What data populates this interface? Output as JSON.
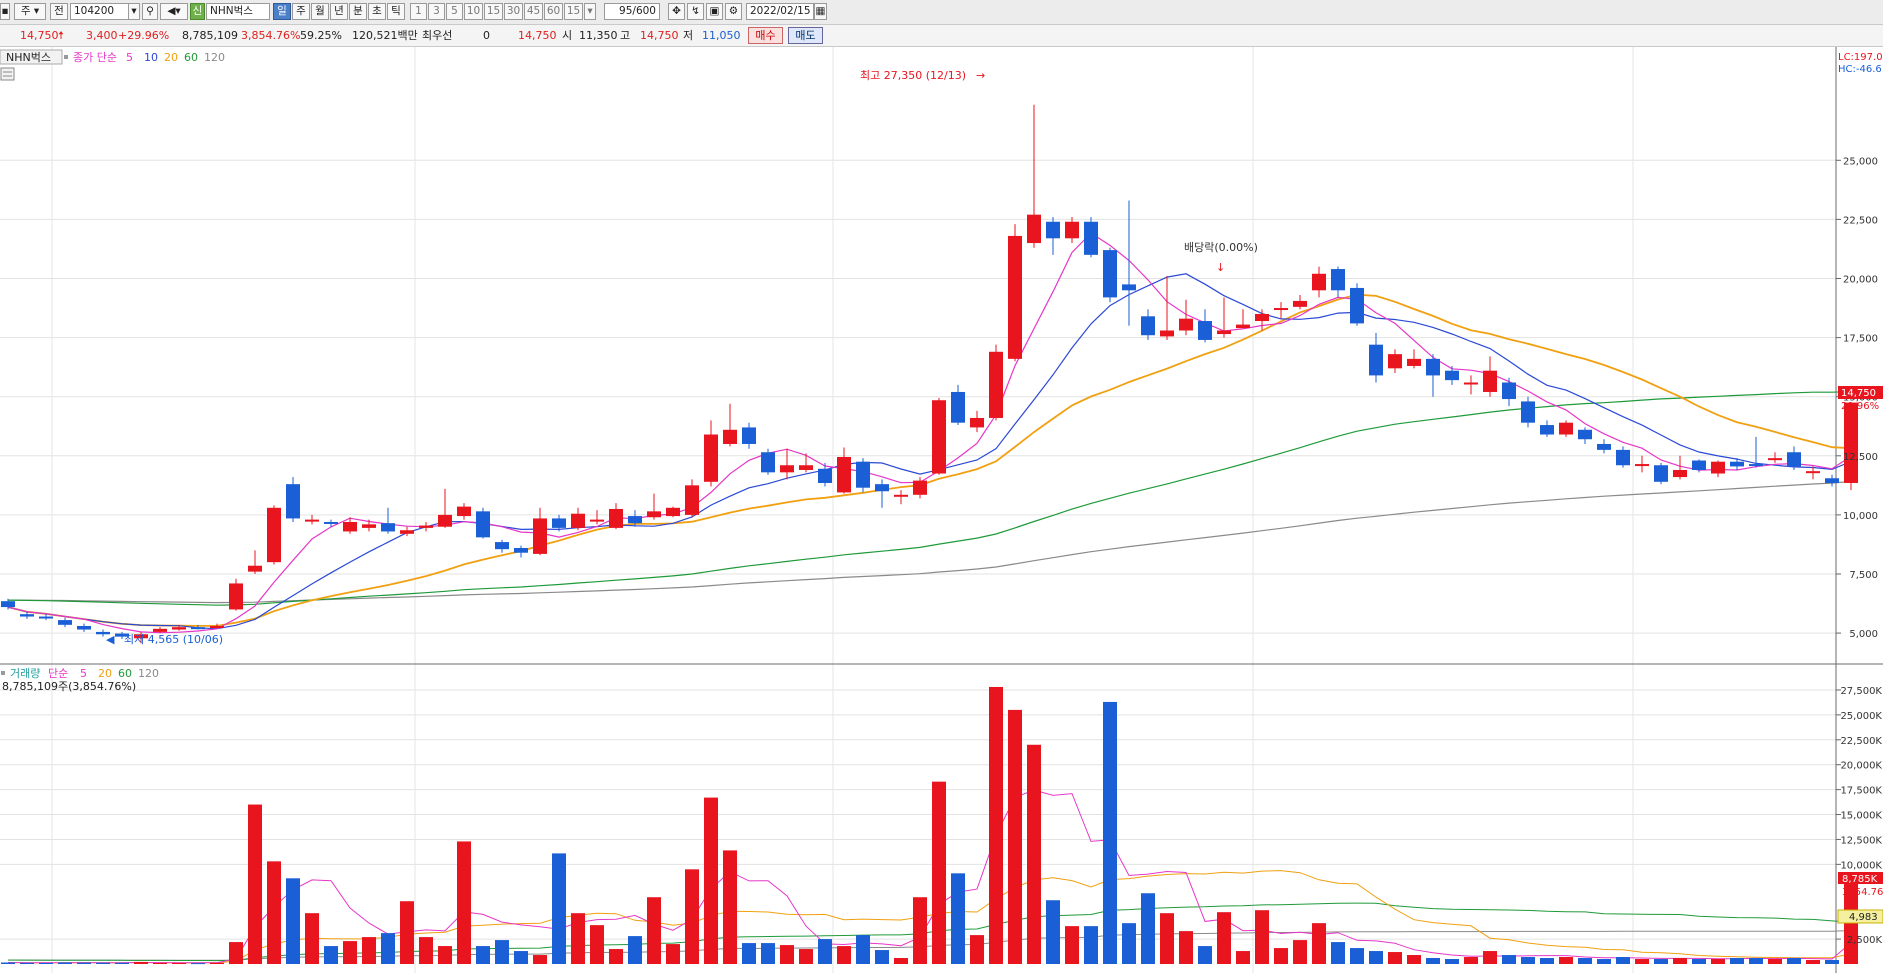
{
  "toolbar": {
    "market_label": "주",
    "all_label": "전",
    "code": "104200",
    "badge": "신",
    "stock_name": "NHN벅스",
    "period_tabs": [
      "일",
      "주",
      "월",
      "년",
      "분",
      "초",
      "틱"
    ],
    "intervals": [
      "1",
      "3",
      "5",
      "10",
      "15",
      "30",
      "45",
      "60",
      "15"
    ],
    "count": "95/600",
    "date": "2022/02/15"
  },
  "infobar": {
    "price": "14,750",
    "change": "3,400",
    "change_pct": "+29.96%",
    "volume": "8,785,109",
    "volume_ratio": "3,854.76%",
    "turnover": "59.25%",
    "amount": "120,521백만",
    "pref_label": "최우선",
    "pref_value": "0",
    "price2": "14,750",
    "open_label": "시",
    "open": "11,350",
    "high_label": "고",
    "high": "14,750",
    "low_label": "저",
    "low": "11,050",
    "buy_label": "매수",
    "sell_label": "매도"
  },
  "price_panel": {
    "name_tab": "NHN벅스",
    "ma_title": "종가 단순",
    "ma_periods": [
      "5",
      "10",
      "20",
      "60",
      "120"
    ],
    "high_annotation": "최고 27,350 (12/13)",
    "low_annotation": "최저 4,565 (10/06)",
    "dividend_label": "배당락(0.00%)",
    "lc_label": "LC:197.0",
    "hc_label": "HC:-46.6",
    "last_price_tag": "14,750",
    "last_pct_tag": "29.96%",
    "y_ticks": [
      "25,000",
      "22,500",
      "20,000",
      "17,500",
      "15,000",
      "12,500",
      "10,000",
      "7,500",
      "5,000"
    ]
  },
  "volume_panel": {
    "title": "거래량",
    "ma_title": "단순",
    "ma_periods": [
      "5",
      "20",
      "60",
      "120"
    ],
    "volume_text": "8,785,109주(3,854.76%)",
    "last_vol_tag": "8,785K",
    "last_ratio_tag": "3854.76",
    "ma_tag": "4,983",
    "y_ticks": [
      "27,500K",
      "25,000K",
      "22,500K",
      "20,000K",
      "17,500K",
      "15,000K",
      "12,500K",
      "10,000K",
      "2,500K"
    ]
  },
  "colors": {
    "up": "#e8141e",
    "down": "#1a5fd6",
    "ma5": "#e636c8",
    "ma10": "#2a49d6",
    "ma20": "#f0a010",
    "ma60": "#1f9a3a",
    "ma120": "#8a8a8a"
  },
  "chart_data": {
    "type": "candlestick",
    "price_ylim": [
      4200,
      29200
    ],
    "volume_ylim": [
      0,
      28500
    ],
    "candles": [
      {
        "o": 6350,
        "c": 6100,
        "h": 6450,
        "l": 6000,
        "v": 150
      },
      {
        "o": 5800,
        "c": 5700,
        "h": 5900,
        "l": 5600,
        "v": 120
      },
      {
        "o": 5700,
        "c": 5650,
        "h": 5800,
        "l": 5550,
        "v": 110
      },
      {
        "o": 5550,
        "c": 5350,
        "h": 5650,
        "l": 5250,
        "v": 160
      },
      {
        "o": 5300,
        "c": 5150,
        "h": 5400,
        "l": 5050,
        "v": 140
      },
      {
        "o": 5050,
        "c": 4950,
        "h": 5150,
        "l": 4850,
        "v": 130
      },
      {
        "o": 4980,
        "c": 4850,
        "h": 5050,
        "l": 4750,
        "v": 120
      },
      {
        "o": 4780,
        "c": 4950,
        "h": 5050,
        "l": 4565,
        "v": 210
      },
      {
        "o": 5050,
        "c": 5180,
        "h": 5250,
        "l": 5000,
        "v": 110
      },
      {
        "o": 5150,
        "c": 5250,
        "h": 5350,
        "l": 5100,
        "v": 100
      },
      {
        "o": 5250,
        "c": 5220,
        "h": 5350,
        "l": 5150,
        "v": 90
      },
      {
        "o": 5250,
        "c": 5300,
        "h": 5400,
        "l": 5200,
        "v": 120
      },
      {
        "o": 6000,
        "c": 7100,
        "h": 7300,
        "l": 5950,
        "v": 2200
      },
      {
        "o": 7600,
        "c": 7850,
        "h": 8500,
        "l": 7500,
        "v": 16000
      },
      {
        "o": 8000,
        "c": 10300,
        "h": 10400,
        "l": 7900,
        "v": 10300
      },
      {
        "o": 11300,
        "c": 9850,
        "h": 11600,
        "l": 9700,
        "v": 8600
      },
      {
        "o": 9800,
        "c": 9800,
        "h": 10000,
        "l": 9600,
        "v": 5100
      },
      {
        "o": 9700,
        "c": 9650,
        "h": 9800,
        "l": 9500,
        "v": 1800
      },
      {
        "o": 9300,
        "c": 9700,
        "h": 9900,
        "l": 9200,
        "v": 2300
      },
      {
        "o": 9450,
        "c": 9600,
        "h": 9800,
        "l": 9300,
        "v": 2700
      },
      {
        "o": 9650,
        "c": 9300,
        "h": 10300,
        "l": 9200,
        "v": 3100
      },
      {
        "o": 9200,
        "c": 9350,
        "h": 9500,
        "l": 9100,
        "v": 6300
      },
      {
        "o": 9450,
        "c": 9550,
        "h": 9700,
        "l": 9300,
        "v": 2700
      },
      {
        "o": 9500,
        "c": 10000,
        "h": 11100,
        "l": 9450,
        "v": 1800
      },
      {
        "o": 9950,
        "c": 10350,
        "h": 10500,
        "l": 9800,
        "v": 12300
      },
      {
        "o": 10150,
        "c": 9050,
        "h": 10300,
        "l": 9000,
        "v": 1800
      },
      {
        "o": 8850,
        "c": 8550,
        "h": 8950,
        "l": 8400,
        "v": 2400
      },
      {
        "o": 8600,
        "c": 8400,
        "h": 8700,
        "l": 8200,
        "v": 1300
      },
      {
        "o": 8350,
        "c": 9850,
        "h": 10300,
        "l": 8300,
        "v": 900
      },
      {
        "o": 9850,
        "c": 9450,
        "h": 10000,
        "l": 9300,
        "v": 11100
      },
      {
        "o": 9450,
        "c": 10050,
        "h": 10300,
        "l": 9350,
        "v": 5100
      },
      {
        "o": 9800,
        "c": 9800,
        "h": 10200,
        "l": 9600,
        "v": 3900
      },
      {
        "o": 9450,
        "c": 10250,
        "h": 10500,
        "l": 9400,
        "v": 1500
      },
      {
        "o": 9950,
        "c": 9650,
        "h": 10200,
        "l": 9500,
        "v": 2800
      },
      {
        "o": 9900,
        "c": 10150,
        "h": 10900,
        "l": 9800,
        "v": 6700
      },
      {
        "o": 9950,
        "c": 10300,
        "h": 10350,
        "l": 9900,
        "v": 2000
      },
      {
        "o": 10000,
        "c": 11250,
        "h": 11500,
        "l": 9900,
        "v": 9500
      },
      {
        "o": 11400,
        "c": 13400,
        "h": 14000,
        "l": 11200,
        "v": 16700
      },
      {
        "o": 13000,
        "c": 13600,
        "h": 14700,
        "l": 12900,
        "v": 11400
      },
      {
        "o": 13700,
        "c": 13000,
        "h": 13900,
        "l": 12800,
        "v": 2100
      },
      {
        "o": 12650,
        "c": 11800,
        "h": 12800,
        "l": 11700,
        "v": 2100
      },
      {
        "o": 11800,
        "c": 12100,
        "h": 12800,
        "l": 11500,
        "v": 1900
      },
      {
        "o": 11900,
        "c": 12100,
        "h": 12600,
        "l": 11800,
        "v": 1500
      },
      {
        "o": 11950,
        "c": 11350,
        "h": 12200,
        "l": 11200,
        "v": 2500
      },
      {
        "o": 10950,
        "c": 12450,
        "h": 12850,
        "l": 10900,
        "v": 1800
      },
      {
        "o": 12250,
        "c": 11150,
        "h": 12400,
        "l": 10950,
        "v": 2900
      },
      {
        "o": 11300,
        "c": 11000,
        "h": 11500,
        "l": 10300,
        "v": 1400
      },
      {
        "o": 10850,
        "c": 10850,
        "h": 11050,
        "l": 10450,
        "v": 600
      },
      {
        "o": 10850,
        "c": 11450,
        "h": 11600,
        "l": 10700,
        "v": 6700
      },
      {
        "o": 11750,
        "c": 14850,
        "h": 14950,
        "l": 11700,
        "v": 18300
      },
      {
        "o": 15200,
        "c": 13900,
        "h": 15500,
        "l": 13800,
        "v": 9100
      },
      {
        "o": 13700,
        "c": 14100,
        "h": 14400,
        "l": 13500,
        "v": 2900
      },
      {
        "o": 14100,
        "c": 16900,
        "h": 17200,
        "l": 14000,
        "v": 27800
      },
      {
        "o": 16600,
        "c": 21800,
        "h": 22300,
        "l": 16500,
        "v": 25500
      },
      {
        "o": 21500,
        "c": 22700,
        "h": 27350,
        "l": 21300,
        "v": 22000
      },
      {
        "o": 22400,
        "c": 21700,
        "h": 22600,
        "l": 21000,
        "v": 6400
      },
      {
        "o": 21700,
        "c": 22400,
        "h": 22600,
        "l": 21500,
        "v": 3800
      },
      {
        "o": 22400,
        "c": 21000,
        "h": 22600,
        "l": 20900,
        "v": 3800
      },
      {
        "o": 21200,
        "c": 19200,
        "h": 21300,
        "l": 19000,
        "v": 26300
      },
      {
        "o": 19750,
        "c": 19500,
        "h": 23300,
        "l": 18000,
        "v": 4100
      },
      {
        "o": 18400,
        "c": 17600,
        "h": 18700,
        "l": 17400,
        "v": 7100
      },
      {
        "o": 17550,
        "c": 17800,
        "h": 20100,
        "l": 17400,
        "v": 5100
      },
      {
        "o": 17800,
        "c": 18300,
        "h": 19100,
        "l": 17600,
        "v": 3300
      },
      {
        "o": 18200,
        "c": 17400,
        "h": 18700,
        "l": 17300,
        "v": 1800
      },
      {
        "o": 17650,
        "c": 17800,
        "h": 19200,
        "l": 17500,
        "v": 5200
      },
      {
        "o": 17900,
        "c": 18050,
        "h": 18700,
        "l": 17900,
        "v": 1300
      },
      {
        "o": 18200,
        "c": 18500,
        "h": 18700,
        "l": 17800,
        "v": 5400
      },
      {
        "o": 18700,
        "c": 18750,
        "h": 19000,
        "l": 18300,
        "v": 1600
      },
      {
        "o": 18800,
        "c": 19050,
        "h": 19300,
        "l": 18700,
        "v": 2400
      },
      {
        "o": 19500,
        "c": 20200,
        "h": 20500,
        "l": 19200,
        "v": 4100
      },
      {
        "o": 20400,
        "c": 19500,
        "h": 20500,
        "l": 19200,
        "v": 2200
      },
      {
        "o": 19600,
        "c": 18100,
        "h": 19800,
        "l": 18000,
        "v": 1600
      },
      {
        "o": 17200,
        "c": 15900,
        "h": 17700,
        "l": 15600,
        "v": 1300
      },
      {
        "o": 16200,
        "c": 16800,
        "h": 17000,
        "l": 16000,
        "v": 1200
      },
      {
        "o": 16300,
        "c": 16600,
        "h": 17000,
        "l": 16200,
        "v": 900
      },
      {
        "o": 16600,
        "c": 15900,
        "h": 16800,
        "l": 15000,
        "v": 600
      },
      {
        "o": 16100,
        "c": 15700,
        "h": 16300,
        "l": 15500,
        "v": 500
      },
      {
        "o": 15600,
        "c": 15600,
        "h": 15900,
        "l": 15100,
        "v": 700
      },
      {
        "o": 15200,
        "c": 16100,
        "h": 16700,
        "l": 15000,
        "v": 1300
      },
      {
        "o": 15600,
        "c": 14900,
        "h": 15800,
        "l": 14600,
        "v": 900
      },
      {
        "o": 14800,
        "c": 13900,
        "h": 15000,
        "l": 13700,
        "v": 700
      },
      {
        "o": 13800,
        "c": 13400,
        "h": 14000,
        "l": 13300,
        "v": 600
      },
      {
        "o": 13400,
        "c": 13900,
        "h": 14000,
        "l": 13300,
        "v": 700
      },
      {
        "o": 13600,
        "c": 13200,
        "h": 13700,
        "l": 13000,
        "v": 600
      },
      {
        "o": 13000,
        "c": 12750,
        "h": 13200,
        "l": 12600,
        "v": 500
      },
      {
        "o": 12750,
        "c": 12100,
        "h": 12900,
        "l": 12000,
        "v": 700
      },
      {
        "o": 12100,
        "c": 12150,
        "h": 12500,
        "l": 11800,
        "v": 500
      },
      {
        "o": 12100,
        "c": 11400,
        "h": 12200,
        "l": 11300,
        "v": 500
      },
      {
        "o": 11600,
        "c": 11900,
        "h": 12500,
        "l": 11500,
        "v": 600
      },
      {
        "o": 12300,
        "c": 11900,
        "h": 12350,
        "l": 11800,
        "v": 500
      },
      {
        "o": 11750,
        "c": 12250,
        "h": 12300,
        "l": 11600,
        "v": 500
      },
      {
        "o": 12250,
        "c": 12050,
        "h": 12400,
        "l": 11900,
        "v": 600
      },
      {
        "o": 12150,
        "c": 12100,
        "h": 13300,
        "l": 12000,
        "v": 600
      },
      {
        "o": 12400,
        "c": 12400,
        "h": 12650,
        "l": 12200,
        "v": 500
      },
      {
        "o": 12650,
        "c": 12050,
        "h": 12900,
        "l": 11900,
        "v": 600
      },
      {
        "o": 11800,
        "c": 11850,
        "h": 12050,
        "l": 11500,
        "v": 400
      },
      {
        "o": 11550,
        "c": 11350,
        "h": 11700,
        "l": 11200,
        "v": 400
      },
      {
        "o": 11350,
        "c": 14750,
        "h": 14750,
        "l": 11050,
        "v": 8785
      }
    ]
  }
}
